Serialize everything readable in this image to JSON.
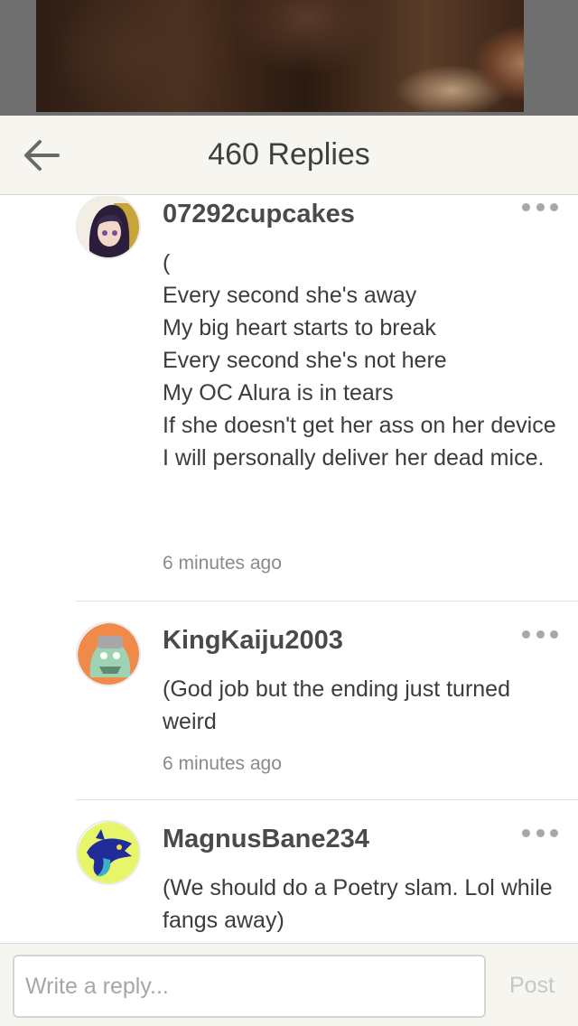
{
  "header": {
    "title": "460 Replies",
    "back_icon": "arrow-left-icon"
  },
  "comments": [
    {
      "username": "07292cupcakes",
      "body": "(\nEvery second she's away\nMy big heart starts to break\nEvery second she's not here\nMy OC Alura is in tears\nIf she doesn't get her ass on her device\nI will personally deliver her dead mice.",
      "time": "6 minutes ago",
      "more_icon": "more-dots-icon"
    },
    {
      "username": "KingKaiju2003",
      "body": "(God job but the ending just turned weird",
      "time": "6 minutes ago",
      "more_icon": "more-dots-icon"
    },
    {
      "username": "MagnusBane234",
      "body": "(We should do a Poetry slam. Lol while fangs away)",
      "more_icon": "more-dots-icon"
    }
  ],
  "footer": {
    "reply_placeholder": "Write a reply...",
    "post_label": "Post"
  },
  "colors": {
    "header_bg": "#f6f5f0",
    "text": "#3c3c3c",
    "muted": "#8a8a8a",
    "post_disabled": "#c7c7c7"
  }
}
